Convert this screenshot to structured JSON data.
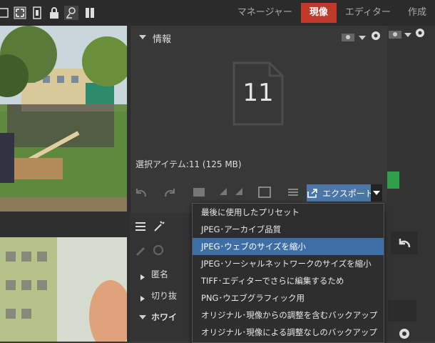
{
  "toolbar": {
    "icons": [
      "crop-icon",
      "expand-icon",
      "filmstrip-icon",
      "lock-icon",
      "user-search-icon",
      "pause-icon"
    ]
  },
  "modes": {
    "manager": "マネージャー",
    "develop": "現像",
    "editor": "エディター",
    "create": "作成"
  },
  "info_panel": {
    "title": "情報",
    "count": "11",
    "selection": "選択アイテム:11 (125 MB)"
  },
  "export": {
    "label": "エクスポート"
  },
  "menu": {
    "items": [
      "最後に使用したプリセット",
      "JPEG･アーカイブ品質",
      "JPEG･ウェブのサイズを縮小",
      "JPEG･ソーシャルネットワークのサイズを縮小",
      "TIFF･エディターでさらに編集するため",
      "PNG･ウエブグラフィック用",
      "オリジナル･現像からの調整を含むバックアップ",
      "オリジナル･現像による調整なしのバックアップ"
    ],
    "highlighted_index": 2
  },
  "side": {
    "row1": "匿名",
    "row2": "切り抜",
    "row3": "ホワイ"
  },
  "colors": {
    "accent": "#c0392b",
    "export": "#4a76a8",
    "highlight": "#3d6fa6"
  }
}
